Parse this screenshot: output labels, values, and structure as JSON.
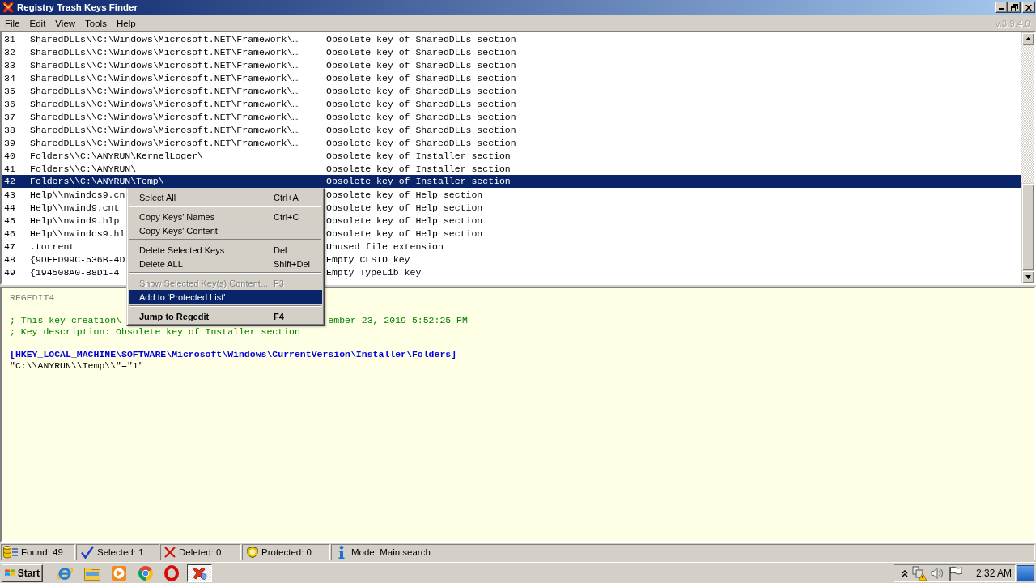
{
  "window": {
    "title": "Registry Trash Keys Finder",
    "version": "v.3.9.4.0"
  },
  "menu": [
    "File",
    "Edit",
    "View",
    "Tools",
    "Help"
  ],
  "results": {
    "rows": [
      {
        "number": "31",
        "key": "SharedDLLs\\\\C:\\Windows\\Microsoft.NET\\Framework\\…",
        "description": "Obsolete key of SharedDLLs section",
        "selected": false
      },
      {
        "number": "32",
        "key": "SharedDLLs\\\\C:\\Windows\\Microsoft.NET\\Framework\\…",
        "description": "Obsolete key of SharedDLLs section",
        "selected": false
      },
      {
        "number": "33",
        "key": "SharedDLLs\\\\C:\\Windows\\Microsoft.NET\\Framework\\…",
        "description": "Obsolete key of SharedDLLs section",
        "selected": false
      },
      {
        "number": "34",
        "key": "SharedDLLs\\\\C:\\Windows\\Microsoft.NET\\Framework\\…",
        "description": "Obsolete key of SharedDLLs section",
        "selected": false
      },
      {
        "number": "35",
        "key": "SharedDLLs\\\\C:\\Windows\\Microsoft.NET\\Framework\\…",
        "description": "Obsolete key of SharedDLLs section",
        "selected": false
      },
      {
        "number": "36",
        "key": "SharedDLLs\\\\C:\\Windows\\Microsoft.NET\\Framework\\…",
        "description": "Obsolete key of SharedDLLs section",
        "selected": false
      },
      {
        "number": "37",
        "key": "SharedDLLs\\\\C:\\Windows\\Microsoft.NET\\Framework\\…",
        "description": "Obsolete key of SharedDLLs section",
        "selected": false
      },
      {
        "number": "38",
        "key": "SharedDLLs\\\\C:\\Windows\\Microsoft.NET\\Framework\\…",
        "description": "Obsolete key of SharedDLLs section",
        "selected": false
      },
      {
        "number": "39",
        "key": "SharedDLLs\\\\C:\\Windows\\Microsoft.NET\\Framework\\…",
        "description": "Obsolete key of SharedDLLs section",
        "selected": false
      },
      {
        "number": "40",
        "key": "Folders\\\\C:\\ANYRUN\\KernelLoger\\",
        "description": "Obsolete key of Installer section",
        "selected": false
      },
      {
        "number": "41",
        "key": "Folders\\\\C:\\ANYRUN\\",
        "description": "Obsolete key of Installer section",
        "selected": false
      },
      {
        "number": "42",
        "key": "Folders\\\\C:\\ANYRUN\\Temp\\",
        "description": "Obsolete key of Installer section",
        "selected": true
      },
      {
        "number": "43",
        "key": "Help\\\\nwindcs9.cn",
        "description": "Obsolete key of Help section",
        "selected": false
      },
      {
        "number": "44",
        "key": "Help\\\\nwind9.cnt",
        "description": "Obsolete key of Help section",
        "selected": false
      },
      {
        "number": "45",
        "key": "Help\\\\nwind9.hlp",
        "description": "Obsolete key of Help section",
        "selected": false
      },
      {
        "number": "46",
        "key": "Help\\\\nwindcs9.hl",
        "description": "Obsolete key of Help section",
        "selected": false
      },
      {
        "number": "47",
        "key": ".torrent",
        "description": "Unused file extension",
        "selected": false
      },
      {
        "number": "48",
        "key": "{9DFFD99C-536B-4D",
        "description": "Empty CLSID key",
        "selected": false
      },
      {
        "number": "49",
        "key": "{194508A0-B8D1-4",
        "description": "Empty TypeLib key",
        "selected": false
      }
    ]
  },
  "context_menu": {
    "items": [
      {
        "kind": "item",
        "label": "Select All",
        "shortcut": "Ctrl+A",
        "selected": false,
        "disabled": false,
        "default": false
      },
      {
        "kind": "separator"
      },
      {
        "kind": "item",
        "label": "Copy Keys' Names",
        "shortcut": "Ctrl+C",
        "selected": false,
        "disabled": false,
        "default": false
      },
      {
        "kind": "item",
        "label": "Copy Keys' Content",
        "selected": false,
        "disabled": false,
        "default": false
      },
      {
        "kind": "separator"
      },
      {
        "kind": "item",
        "label": "Delete Selected Keys",
        "shortcut": "Del",
        "selected": false,
        "disabled": false,
        "default": false
      },
      {
        "kind": "item",
        "label": "Delete ALL",
        "shortcut": "Shift+Del",
        "selected": false,
        "disabled": false,
        "default": false
      },
      {
        "kind": "separator"
      },
      {
        "kind": "item",
        "label": "Show Selected Key(s) Content...",
        "shortcut": "F3",
        "selected": false,
        "disabled": true,
        "default": false
      },
      {
        "kind": "item",
        "label": "Add to 'Protected List'",
        "selected": true,
        "disabled": false,
        "default": false
      },
      {
        "kind": "separator"
      },
      {
        "kind": "item",
        "label": "Jump to Regedit",
        "shortcut": "F4",
        "selected": false,
        "disabled": false,
        "default": true
      }
    ]
  },
  "preview": {
    "lines": [
      {
        "kind": "header",
        "parts": [
          "REGEDIT4"
        ]
      },
      {
        "kind": "blank"
      },
      {
        "kind": "comment",
        "parts": [
          "; This key creation\\",
          "ember 23, 2019 5:52:25 PM"
        ]
      },
      {
        "kind": "comment",
        "parts": [
          "; Key description: Obsolete key of Installer section"
        ]
      },
      {
        "kind": "blank"
      },
      {
        "kind": "key",
        "parts": [
          "[HKEY_LOCAL_MACHINE\\SOFTWARE\\Microsoft\\Windows\\CurrentVersion\\Installer\\Folders]"
        ]
      },
      {
        "kind": "value",
        "parts": [
          "\"C:\\\\ANYRUN\\\\Temp\\\\\"=\"1\""
        ]
      }
    ]
  },
  "status_bar": [
    {
      "kind": "found",
      "text": "Found: 49"
    },
    {
      "kind": "selected",
      "text": "Selected: 1"
    },
    {
      "kind": "deleted",
      "text": "Deleted: 0"
    },
    {
      "kind": "protected",
      "text": "Protected: 0"
    },
    {
      "kind": "mode",
      "text": "Mode: Main search"
    }
  ],
  "taskbar": {
    "start": "Start",
    "clock": "2:32 AM"
  }
}
